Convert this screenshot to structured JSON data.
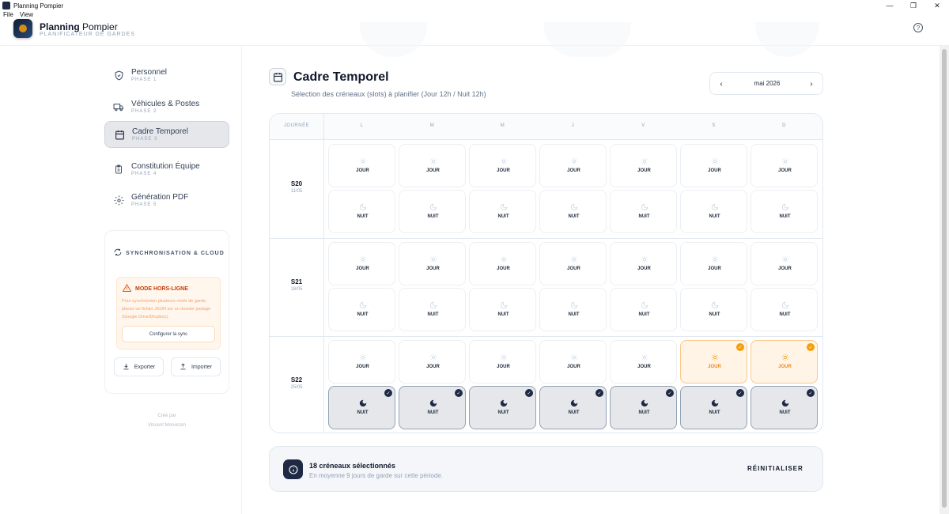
{
  "window": {
    "title": "Planning Pompier",
    "min": "—",
    "max": "❐",
    "close": "✕"
  },
  "menu": [
    "File",
    "View"
  ],
  "header": {
    "title_bold": "Planning",
    "title_light": " Pompier",
    "subtitle": "PLANIFICATEUR DE GARDES"
  },
  "sidebar": {
    "items": [
      {
        "label": "Personnel",
        "phase": "PHASE 1",
        "icon": "shield-icon"
      },
      {
        "label": "Véhicules & Postes",
        "phase": "PHASE 2",
        "icon": "truck-icon"
      },
      {
        "label": "Cadre Temporel",
        "phase": "PHASE 3",
        "icon": "calendar-icon",
        "active": true
      },
      {
        "label": "Constitution Équipe",
        "phase": "PHASE 4",
        "icon": "clipboard-icon"
      },
      {
        "label": "Génération PDF",
        "phase": "PHASE 5",
        "icon": "gear-icon"
      }
    ],
    "sync": {
      "title": "SYNCHRONISATION & CLOUD",
      "offline_title": "MODE HORS-LIGNE",
      "offline_text": "Pour synchroniser plusieurs chefs de garde, placez un fichier JSON sur un dossier partagé (Google Drive/Dropbox).",
      "configure": "Configurer la sync",
      "export": "Exporter",
      "import": "Importer"
    },
    "credit_line1": "Créé par",
    "credit_line2": "Vincent Morvezen"
  },
  "main": {
    "title": "Cadre Temporel",
    "subtitle": "Sélection des créneaux (slots) à planifier (Jour 12h / Nuit 12h)",
    "month": "mai 2026",
    "prev": "‹",
    "next": "›",
    "col_header": "JOURNÉE",
    "days": [
      "L",
      "M",
      "M",
      "J",
      "V",
      "S",
      "D"
    ],
    "weeks": [
      {
        "week": "S20",
        "date": "11/05",
        "day_selected": [
          false,
          false,
          false,
          false,
          false,
          false,
          false
        ],
        "night_selected": [
          false,
          false,
          false,
          false,
          false,
          false,
          false
        ]
      },
      {
        "week": "S21",
        "date": "18/05",
        "day_selected": [
          false,
          false,
          false,
          false,
          false,
          false,
          false
        ],
        "night_selected": [
          false,
          false,
          false,
          false,
          false,
          false,
          false
        ]
      },
      {
        "week": "S22",
        "date": "25/05",
        "day_selected": [
          false,
          false,
          false,
          false,
          false,
          true,
          true
        ],
        "night_selected": [
          true,
          true,
          true,
          true,
          true,
          true,
          true
        ]
      }
    ],
    "slot_day_label": "JOUR",
    "slot_night_label": "NUIT",
    "check_mark": "✓"
  },
  "summary": {
    "title": "18 créneaux sélectionnés",
    "subtitle": "En moyenne 9 jours de garde sur cette période.",
    "reset": "RÉINITIALISER"
  },
  "colors": {
    "accent_orange": "#f59e0b",
    "navy": "#1e2a44",
    "border": "#e2e8f0"
  }
}
